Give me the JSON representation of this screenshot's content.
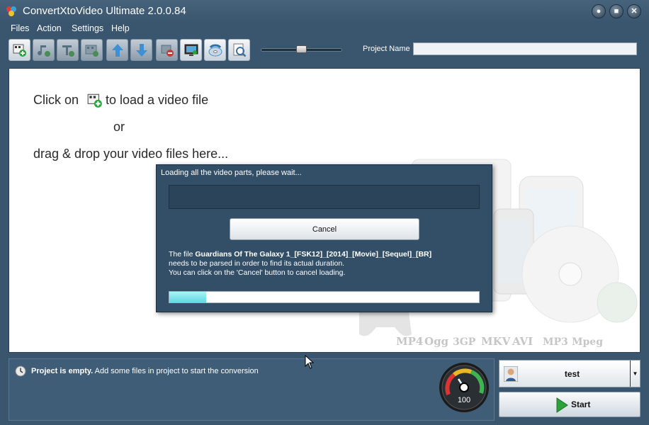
{
  "window": {
    "title": "ConvertXtoVideo Ultimate 2.0.0.84",
    "controls": {
      "minimize": "●",
      "maximize": "■",
      "close": "✕"
    }
  },
  "menu": [
    "Files",
    "Action",
    "Settings",
    "Help"
  ],
  "toolbar": {
    "buttons": [
      {
        "icon": "add-video-icon"
      },
      {
        "icon": "add-audio-icon"
      },
      {
        "icon": "add-subtitle-icon"
      },
      {
        "icon": "add-chapter-icon"
      },
      {
        "icon": "move-up-icon"
      },
      {
        "icon": "move-down-icon"
      },
      {
        "icon": "remove-icon"
      },
      {
        "icon": "preview-screen-icon"
      },
      {
        "icon": "burn-disc-icon"
      },
      {
        "icon": "zoom-icon"
      }
    ],
    "project_name_label": "Project Name",
    "project_name_value": "",
    "zoom_slider_value": 0.5
  },
  "workspace": {
    "hint_line1_before": "Click on",
    "hint_line1_after": "to load a video file",
    "hint_or": "or",
    "hint_line3": "drag & drop your video files here...",
    "formats": [
      "MP4",
      "Ogg",
      "3GP",
      "MKV",
      "AVI",
      "MP3",
      "Mpeg"
    ]
  },
  "dialog": {
    "title": "Loading all the video parts, please wait...",
    "cancel_label": "Cancel",
    "msg_prefix": "The file",
    "file_name": "Guardians Of The Galaxy 1_[FSK12]_[2014]_[Movie]_[Sequel]_[BR]",
    "msg_line2": "needs to be parsed in order to find its actual duration.",
    "msg_line3": "You can click on the 'Cancel' button to cancel loading.",
    "progress": 0.12
  },
  "status": {
    "bold": "Project is empty.",
    "rest": " Add some files in project to start the conversion",
    "gauge_value": "100"
  },
  "profile": {
    "name": "test",
    "dropdown": "▼"
  },
  "start_label": "Start",
  "colors": {
    "window_bg": "#3a566e",
    "dialog_bg": "#334f67",
    "progress_fill": "#5fd9e2",
    "start_green": "#2aa33a"
  }
}
